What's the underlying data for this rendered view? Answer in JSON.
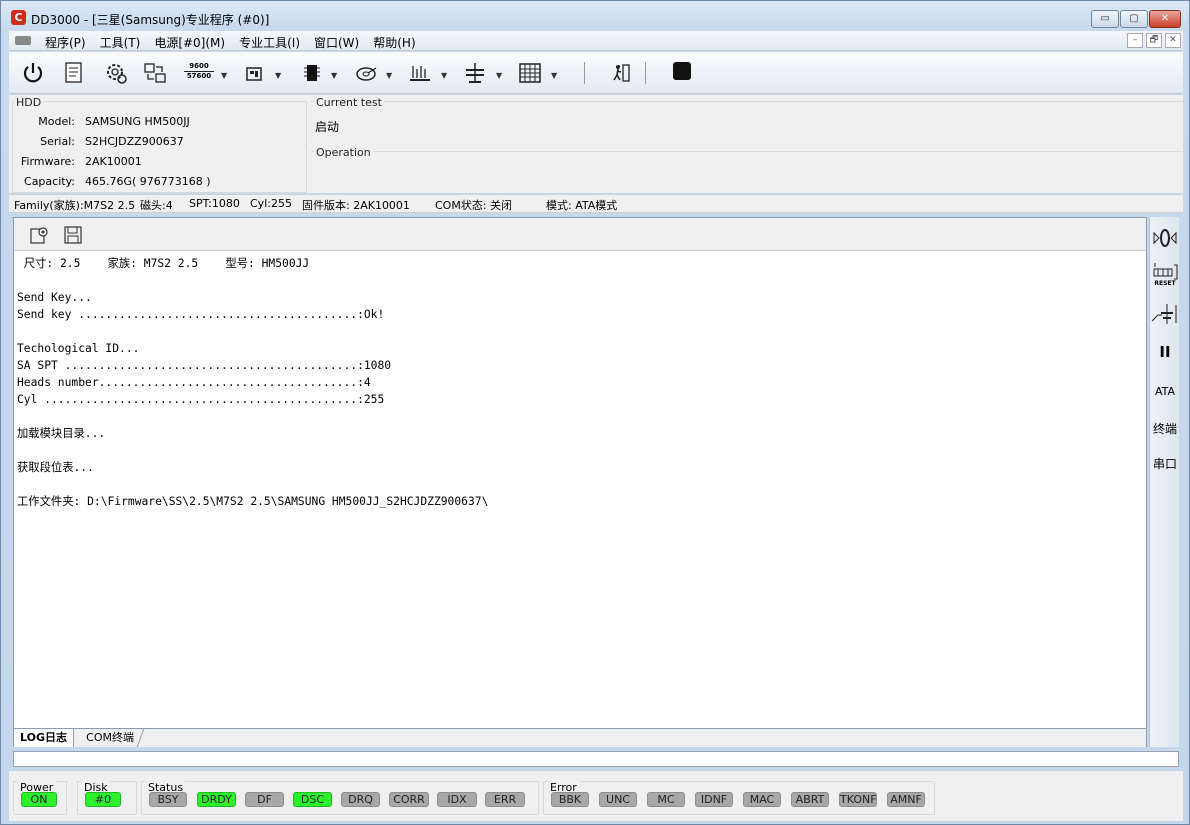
{
  "window": {
    "title": "DD3000 - [三星(Samsung)专业程序 (#0)]",
    "icon_glyph": "C",
    "controls": {
      "minimize": "▭",
      "restore": "▢",
      "close": "✕"
    }
  },
  "menu": {
    "items": [
      "程序(P)",
      "工具(T)",
      "电源[#0](M)",
      "专业工具(I)",
      "窗口(W)",
      "帮助(H)"
    ],
    "mdi_controls": [
      "–",
      "🗗",
      "✕"
    ]
  },
  "toolbar": {
    "items": [
      {
        "name": "power-icon"
      },
      {
        "name": "script-icon"
      },
      {
        "name": "settings-gear-icon"
      },
      {
        "name": "transfer-icon"
      },
      {
        "name": "baud-rate-icon",
        "text_top": "9600",
        "text_bottom": "57600"
      },
      {
        "name": "drive-tools-icon"
      },
      {
        "name": "chip-icon"
      },
      {
        "name": "disk-icon"
      },
      {
        "name": "sector-icon"
      },
      {
        "name": "balance-icon"
      },
      {
        "name": "grid-icon"
      },
      {
        "name": "exit-icon"
      },
      {
        "name": "stop-icon"
      }
    ]
  },
  "hdd": {
    "group_label": "HDD",
    "rows": [
      {
        "key": "Model:",
        "value": "SAMSUNG HM500JJ"
      },
      {
        "key": "Serial:",
        "value": "S2HCJDZZ900637"
      },
      {
        "key": "Firmware:",
        "value": "2AK10001"
      },
      {
        "key": "Capacity:",
        "value": "465.76G( 976773168 )"
      }
    ]
  },
  "current_test": {
    "label": "Current test",
    "value": "启动"
  },
  "operation": {
    "label": "Operation",
    "value": ""
  },
  "family_bar": {
    "items": [
      "Family(家族):M7S2 2.5",
      "磁头:4",
      "SPT:1080",
      "Cyl:255",
      "固件版本: 2AK10001",
      "COM状态: 关闭",
      "模式: ATA模式"
    ]
  },
  "log": {
    "lines": [
      " 尺寸: 2.5    家族: M7S2 2.5    型号: HM500JJ",
      "",
      "Send Key...",
      "Send key .........................................:Ok!",
      "",
      "Techological ID...",
      "SA SPT ...........................................:1080",
      "Heads number......................................:4",
      "Cyl ..............................................:255",
      "",
      "加载模块目录...",
      "",
      "获取段位表...",
      "",
      "工作文件夹: D:\\Firmware\\SS\\2.5\\M7S2 2.5\\SAMSUNG HM500JJ_S2HCJDZZ900637\\"
    ],
    "tabs": [
      "LOG日志",
      "COM终端"
    ]
  },
  "side_panel": {
    "items": [
      "ATA",
      "终端",
      "串口"
    ],
    "reset_label": "RESET",
    "pause_glyph": "II"
  },
  "footer": {
    "power": {
      "label": "Power",
      "led": "ON"
    },
    "disk": {
      "label": "Disk",
      "led": "#0"
    },
    "status": {
      "label": "Status",
      "leds": [
        "BSY",
        "DRDY",
        "DF",
        "DSC",
        "DRQ",
        "CORR",
        "IDX",
        "ERR"
      ],
      "on": [
        "DRDY",
        "DSC"
      ]
    },
    "error": {
      "label": "Error",
      "leds": [
        "BBK",
        "UNC",
        "MC",
        "IDNF",
        "MAC",
        "ABRT",
        "TKONF",
        "AMNF"
      ]
    },
    "colors": {
      "on": "#2df02d",
      "off": "#a8a8a8"
    }
  }
}
